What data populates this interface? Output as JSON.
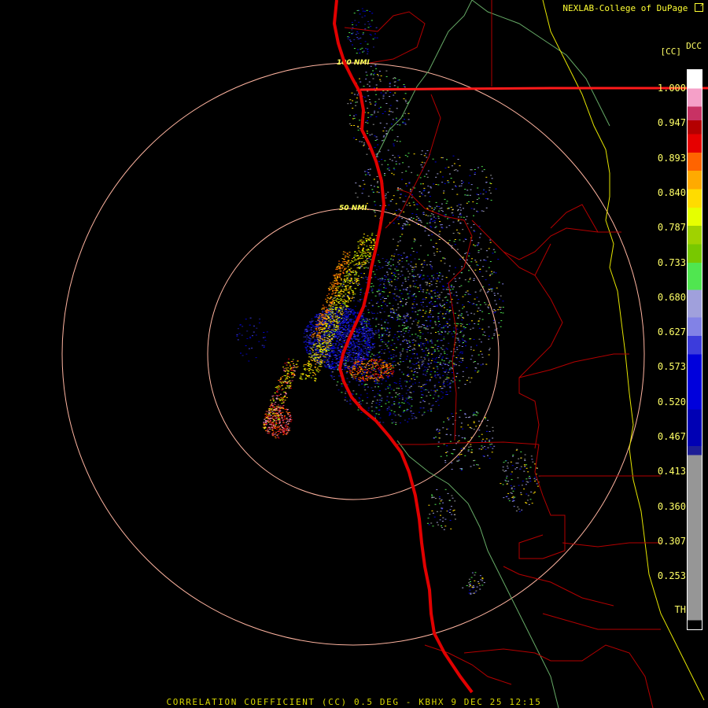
{
  "header": {
    "credit": "NEXLAB-College of DuPage",
    "credit_icon": "external-link-icon"
  },
  "legend": {
    "product_code": "DCC",
    "product_abbrev": "[CC]",
    "labels": [
      "1.000",
      "0.947",
      "0.893",
      "0.840",
      "0.787",
      "0.733",
      "0.680",
      "0.627",
      "0.573",
      "0.520",
      "0.467",
      "0.413",
      "0.360",
      "0.307",
      "0.253",
      "TH"
    ],
    "colors": [
      "#ffffff",
      "#f5a0c8",
      "#c83264",
      "#b40000",
      "#e60000",
      "#ff6400",
      "#ffaa00",
      "#ffdc00",
      "#e6ff00",
      "#a0d200",
      "#78c800",
      "#50e650",
      "#a0a0dc",
      "#8282e6",
      "#3c3cdc",
      "#0000dc",
      "#0000b4",
      "#1e1e96",
      "#969696",
      "#000000"
    ]
  },
  "map": {
    "range_rings": [
      {
        "label": "50 NMI"
      },
      {
        "label": "100 NMI"
      }
    ],
    "colors": {
      "background": "#000000",
      "range_ring": "#ffb4a0",
      "state_border": "#ff0000",
      "county_border": "#b40000",
      "coastline": "#cc0000",
      "interstate": "#ffff00",
      "terrain": "#66cc66"
    }
  },
  "footer": {
    "caption": "CORRELATION COEFFICIENT (CC) 0.5 DEG - KBHX 9 DEC 25 12:15"
  }
}
